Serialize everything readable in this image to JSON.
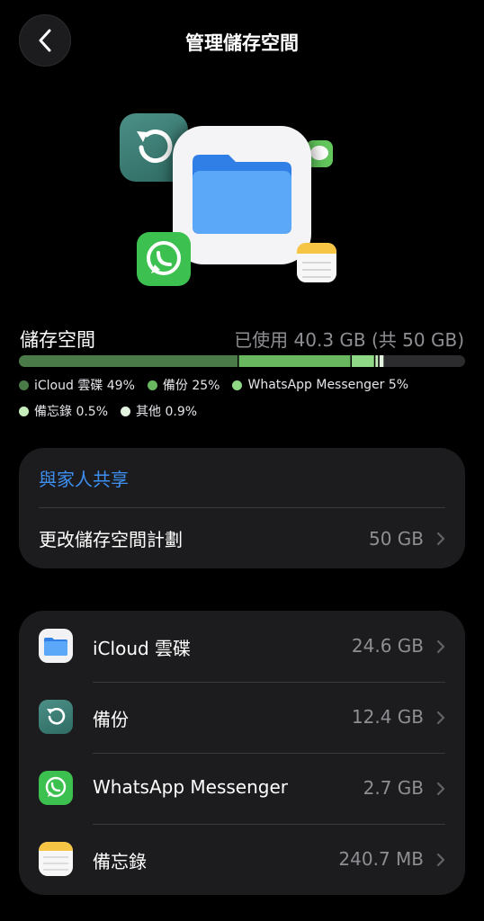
{
  "nav": {
    "title": "管理儲存空間",
    "back_icon": "chevron-left-icon"
  },
  "hero": {
    "icons": [
      "backup-icon",
      "files-folder-icon",
      "whatsapp-icon",
      "messages-icon",
      "notes-icon"
    ]
  },
  "storage": {
    "title": "儲存空間",
    "used_text": "已使用 40.3 GB (共 50 GB)",
    "used_gb": 40.3,
    "total_gb": 50
  },
  "chart_data": {
    "type": "bar",
    "stacked": true,
    "categories": [
      "iCloud 雲碟",
      "備份",
      "WhatsApp Messenger",
      "備忘錄",
      "其他"
    ],
    "values_percent": [
      49,
      25,
      5,
      0.5,
      0.9
    ],
    "colors": [
      "#4a7a48",
      "#69b860",
      "#8fd886",
      "#c7edbd",
      "#e4f3df"
    ]
  },
  "legend": [
    {
      "label": "iCloud 雲碟 49%",
      "color": "#4a7a48"
    },
    {
      "label": "備份 25%",
      "color": "#69b860"
    },
    {
      "label": "WhatsApp Messenger 5%",
      "color": "#8fd886"
    },
    {
      "label": "備忘錄 0.5%",
      "color": "#c7edbd"
    },
    {
      "label": "其他 0.9%",
      "color": "#e4f3df"
    }
  ],
  "plan": {
    "family_share_label": "與家人共享",
    "change_plan_label": "更改儲存空間計劃",
    "change_plan_value": "50 GB"
  },
  "apps": [
    {
      "name": "iCloud 雲碟",
      "size": "24.6 GB",
      "icon": "files-icon"
    },
    {
      "name": "備份",
      "size": "12.4 GB",
      "icon": "backup-icon"
    },
    {
      "name": "WhatsApp Messenger",
      "size": "2.7 GB",
      "icon": "whatsapp-icon"
    },
    {
      "name": "備忘錄",
      "size": "240.7 MB",
      "icon": "notes-icon"
    }
  ],
  "colors": {
    "accent_blue": "#3d8ff2",
    "card_bg": "#1c1c1e",
    "secondary_text": "#8e8e93"
  }
}
